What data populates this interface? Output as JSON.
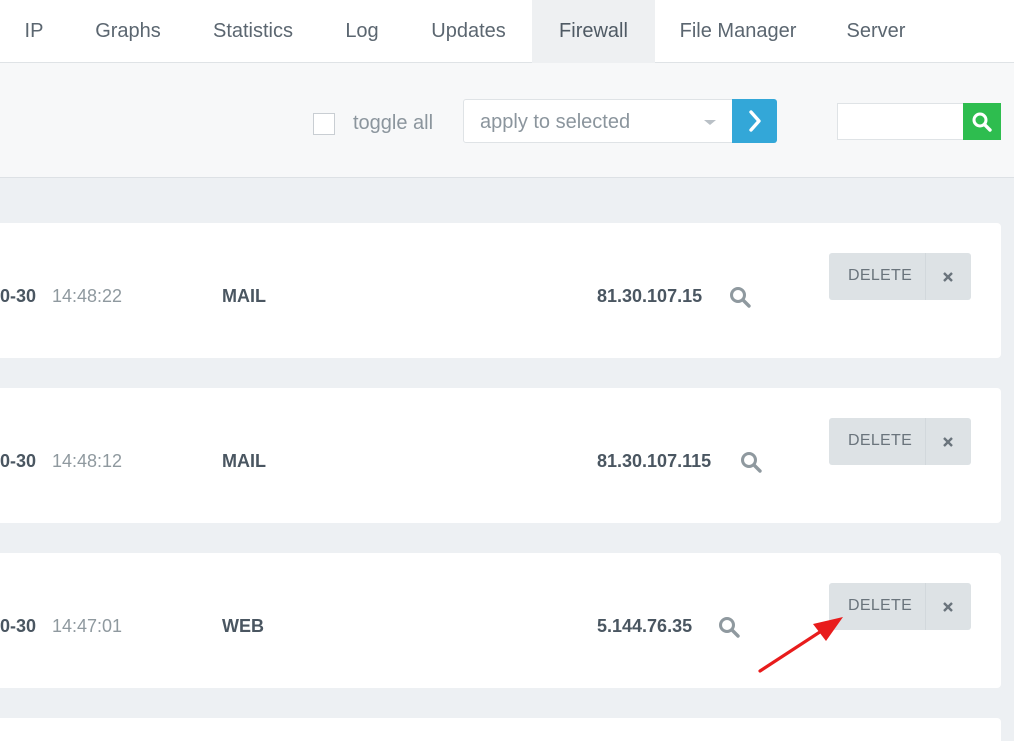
{
  "nav": {
    "items": [
      "IP",
      "Graphs",
      "Statistics",
      "Log",
      "Updates",
      "Firewall",
      "File Manager",
      "Server"
    ],
    "active": "Firewall"
  },
  "toolbar": {
    "toggle_all_label": "toggle all",
    "bulk_action_value": "apply to selected",
    "search_value": ""
  },
  "rows": [
    {
      "date": "0-30",
      "time": "14:48:22",
      "type": "MAIL",
      "ip": "81.30.107.15",
      "action_label": "DELETE"
    },
    {
      "date": "0-30",
      "time": "14:48:12",
      "type": "MAIL",
      "ip": "81.30.107.115",
      "action_label": "DELETE"
    },
    {
      "date": "0-30",
      "time": "14:47:01",
      "type": "WEB",
      "ip": "5.144.76.35",
      "action_label": "DELETE"
    }
  ],
  "colors": {
    "apply_button": "#33a7d8",
    "search_button": "#2ebd4f",
    "annotation_arrow": "#e81c1c"
  }
}
